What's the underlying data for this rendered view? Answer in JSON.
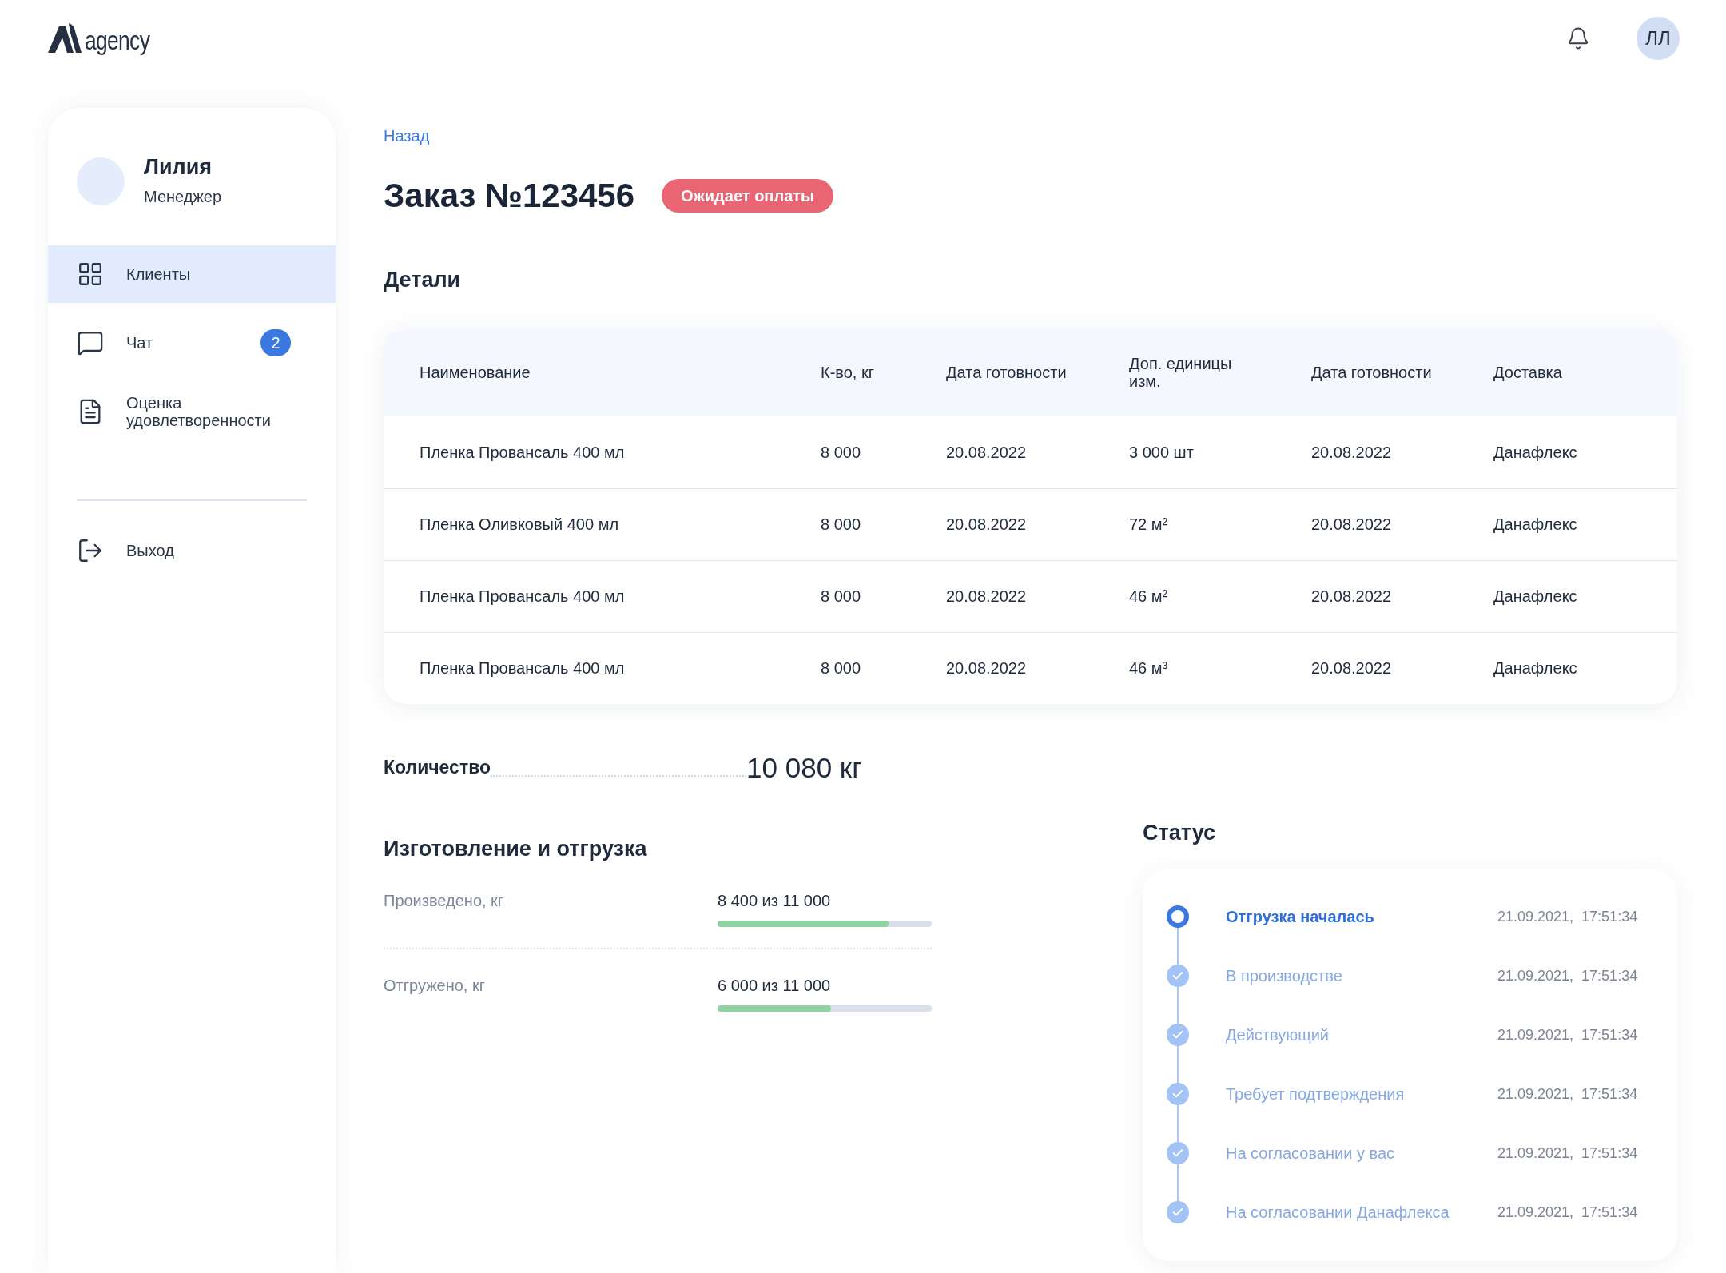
{
  "header": {
    "logo_text": "agency",
    "avatar_initials": "ЛЛ"
  },
  "sidebar": {
    "user": {
      "name": "Лилия",
      "role": "Менеджер"
    },
    "items": [
      {
        "kind": "grid",
        "label": "Клиенты",
        "selected": true
      },
      {
        "kind": "chat",
        "label": "Чат",
        "selected": false,
        "badge": "2"
      },
      {
        "kind": "document",
        "label": "Оценка удовлетворенности",
        "selected": false
      }
    ],
    "logout": {
      "label": "Выход"
    }
  },
  "back_link": "Назад",
  "order": {
    "title": "Заказ №123456",
    "status": "Ожидает оплаты"
  },
  "details": {
    "heading": "Детали",
    "columns": [
      "Наименование",
      "К-во, кг",
      "Дата готовности",
      "Доп. единицы изм.",
      "Дата готовности",
      "Доставка"
    ],
    "rows": [
      [
        "Пленка Провансаль 400 мл",
        "8 000",
        "20.08.2022",
        "3 000 шт",
        "20.08.2022",
        "Данафлекс"
      ],
      [
        "Пленка Оливковый 400 мл",
        "8 000",
        "20.08.2022",
        "72 м²",
        "20.08.2022",
        "Данафлекс"
      ],
      [
        "Пленка Провансаль 400 мл",
        "8 000",
        "20.08.2022",
        "46 м²",
        "20.08.2022",
        "Данафлекс"
      ],
      [
        "Пленка Провансаль 400 мл",
        "8 000",
        "20.08.2022",
        "46 м³",
        "20.08.2022",
        "Данафлекс"
      ]
    ]
  },
  "quantity": {
    "label": "Количество",
    "value": "10 080 кг"
  },
  "production": {
    "heading": "Изготовление и отгрузка",
    "rows": [
      {
        "label": "Произведено, кг",
        "value": "8 400 из 11 000",
        "level": 0.8
      },
      {
        "label": "Отгружено, кг",
        "value": "6 000 из 11 000",
        "level": 0.53
      }
    ]
  },
  "status": {
    "heading": "Статус",
    "items": [
      {
        "label": "Отгрузка началась",
        "time": "21.09.2021,  17:51:34",
        "done": false
      },
      {
        "label": "В производстве",
        "time": "21.09.2021,  17:51:34",
        "done": true
      },
      {
        "label": "Действующий",
        "time": "21.09.2021,  17:51:34",
        "done": true
      },
      {
        "label": "Требует подтверждения",
        "time": "21.09.2021,  17:51:34",
        "done": true
      },
      {
        "label": "На согласовании у вас",
        "time": "21.09.2021,  17:51:34",
        "done": true
      },
      {
        "label": "На согласовании Данафлекса",
        "time": "21.09.2021,  17:51:34",
        "done": true
      }
    ]
  }
}
